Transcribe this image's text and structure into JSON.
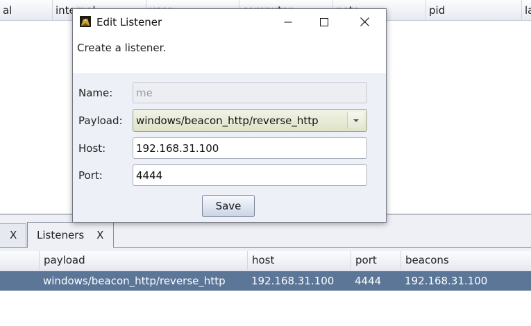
{
  "background_window": {
    "top_table": {
      "columns": [
        "al",
        "internal",
        "user",
        "computer",
        "note",
        "pid",
        "la"
      ]
    },
    "tabs": [
      {
        "label": "",
        "close": "X",
        "active": false
      },
      {
        "label": "Listeners",
        "close": "X",
        "active": true
      }
    ],
    "listeners_table": {
      "columns": [
        "",
        "payload",
        "host",
        "port",
        "beacons"
      ],
      "rows": [
        {
          "name": "",
          "payload": "windows/beacon_http/reverse_http",
          "host": "192.168.31.100",
          "port": "4444",
          "beacons": "192.168.31.100"
        }
      ],
      "selected_row_color": "#5b7697"
    }
  },
  "dialog": {
    "title": "Edit Listener",
    "app_icon": "cobalt-strike-app-icon",
    "controls": {
      "minimize_icon": "minimize-icon",
      "maximize_icon": "maximize-icon",
      "close_icon": "close-icon"
    },
    "description": "Create a listener.",
    "form": {
      "name": {
        "label": "Name:",
        "value": "me",
        "disabled": true
      },
      "payload": {
        "label": "Payload:",
        "value": "windows/beacon_http/reverse_http"
      },
      "host": {
        "label": "Host:",
        "value": "192.168.31.100"
      },
      "port": {
        "label": "Port:",
        "value": "4444"
      }
    },
    "save_label": "Save"
  }
}
